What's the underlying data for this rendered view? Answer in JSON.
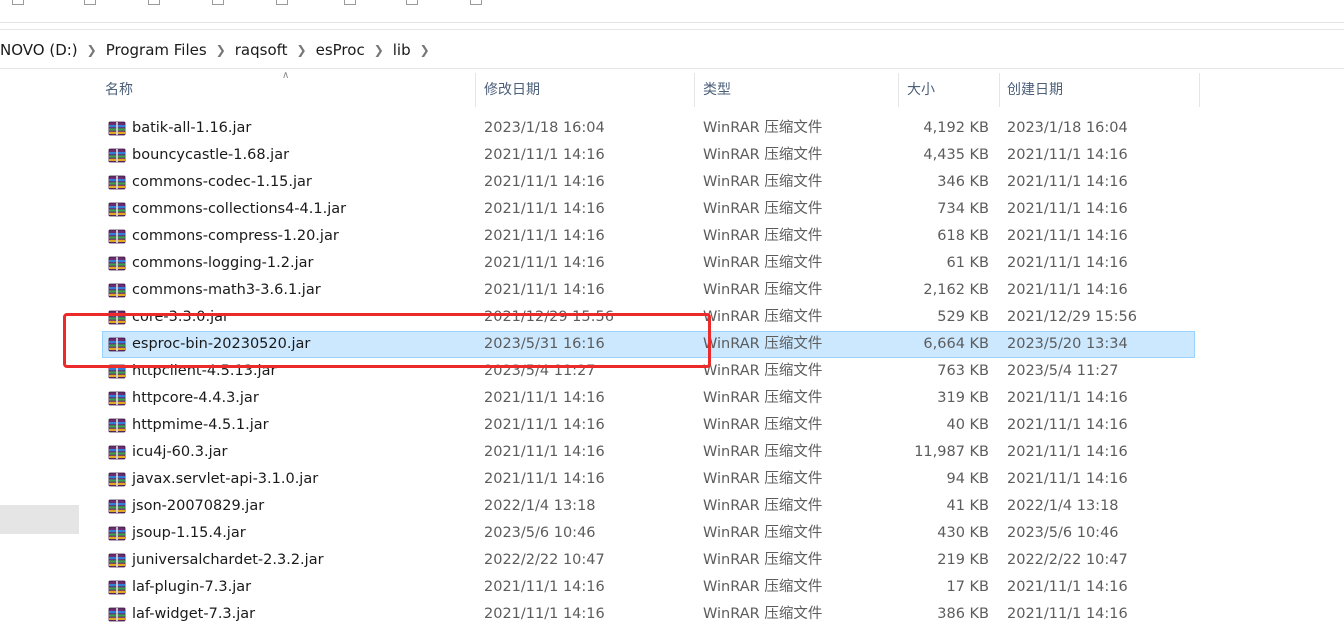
{
  "address": {
    "crumbs": [
      "NOVO (D:)",
      "Program Files",
      "raqsoft",
      "esProc",
      "lib"
    ]
  },
  "columns": {
    "name": "名称",
    "modified": "修改日期",
    "type": "类型",
    "size": "大小",
    "created": "创建日期"
  },
  "files": [
    {
      "name": "batik-all-1.16.jar",
      "modified": "2023/1/18 16:04",
      "type": "WinRAR 压缩文件",
      "size": "4,192 KB",
      "created": "2023/1/18 16:04"
    },
    {
      "name": "bouncycastle-1.68.jar",
      "modified": "2021/11/1 14:16",
      "type": "WinRAR 压缩文件",
      "size": "4,435 KB",
      "created": "2021/11/1 14:16"
    },
    {
      "name": "commons-codec-1.15.jar",
      "modified": "2021/11/1 14:16",
      "type": "WinRAR 压缩文件",
      "size": "346 KB",
      "created": "2021/11/1 14:16"
    },
    {
      "name": "commons-collections4-4.1.jar",
      "modified": "2021/11/1 14:16",
      "type": "WinRAR 压缩文件",
      "size": "734 KB",
      "created": "2021/11/1 14:16"
    },
    {
      "name": "commons-compress-1.20.jar",
      "modified": "2021/11/1 14:16",
      "type": "WinRAR 压缩文件",
      "size": "618 KB",
      "created": "2021/11/1 14:16"
    },
    {
      "name": "commons-logging-1.2.jar",
      "modified": "2021/11/1 14:16",
      "type": "WinRAR 压缩文件",
      "size": "61 KB",
      "created": "2021/11/1 14:16"
    },
    {
      "name": "commons-math3-3.6.1.jar",
      "modified": "2021/11/1 14:16",
      "type": "WinRAR 压缩文件",
      "size": "2,162 KB",
      "created": "2021/11/1 14:16"
    },
    {
      "name": "core-3.3.0.jar",
      "modified": "2021/12/29 15:56",
      "type": "WinRAR 压缩文件",
      "size": "529 KB",
      "created": "2021/12/29 15:56"
    },
    {
      "name": "esproc-bin-20230520.jar",
      "modified": "2023/5/31 16:16",
      "type": "WinRAR 压缩文件",
      "size": "6,664 KB",
      "created": "2023/5/20 13:34",
      "selected": true
    },
    {
      "name": "httpclient-4.5.13.jar",
      "modified": "2023/5/4 11:27",
      "type": "WinRAR 压缩文件",
      "size": "763 KB",
      "created": "2023/5/4 11:27"
    },
    {
      "name": "httpcore-4.4.3.jar",
      "modified": "2021/11/1 14:16",
      "type": "WinRAR 压缩文件",
      "size": "319 KB",
      "created": "2021/11/1 14:16"
    },
    {
      "name": "httpmime-4.5.1.jar",
      "modified": "2021/11/1 14:16",
      "type": "WinRAR 压缩文件",
      "size": "40 KB",
      "created": "2021/11/1 14:16"
    },
    {
      "name": "icu4j-60.3.jar",
      "modified": "2021/11/1 14:16",
      "type": "WinRAR 压缩文件",
      "size": "11,987 KB",
      "created": "2021/11/1 14:16"
    },
    {
      "name": "javax.servlet-api-3.1.0.jar",
      "modified": "2021/11/1 14:16",
      "type": "WinRAR 压缩文件",
      "size": "94 KB",
      "created": "2021/11/1 14:16"
    },
    {
      "name": "json-20070829.jar",
      "modified": "2022/1/4 13:18",
      "type": "WinRAR 压缩文件",
      "size": "41 KB",
      "created": "2022/1/4 13:18"
    },
    {
      "name": "jsoup-1.15.4.jar",
      "modified": "2023/5/6 10:46",
      "type": "WinRAR 压缩文件",
      "size": "430 KB",
      "created": "2023/5/6 10:46"
    },
    {
      "name": "juniversalchardet-2.3.2.jar",
      "modified": "2022/2/22 10:47",
      "type": "WinRAR 压缩文件",
      "size": "219 KB",
      "created": "2022/2/22 10:47"
    },
    {
      "name": "laf-plugin-7.3.jar",
      "modified": "2021/11/1 14:16",
      "type": "WinRAR 压缩文件",
      "size": "17 KB",
      "created": "2021/11/1 14:16"
    },
    {
      "name": "laf-widget-7.3.jar",
      "modified": "2021/11/1 14:16",
      "type": "WinRAR 压缩文件",
      "size": "386 KB",
      "created": "2021/11/1 14:16"
    }
  ],
  "icons": {
    "file": "winrar-archive-icon",
    "breadcrumb_separator": "chevron-right-icon",
    "sort": "sort-ascending-icon"
  },
  "colors": {
    "selection_fill": "#cce8ff",
    "selection_border": "#99d1ff",
    "annotation": "#ec2a2a",
    "header_text": "#4c607a"
  }
}
